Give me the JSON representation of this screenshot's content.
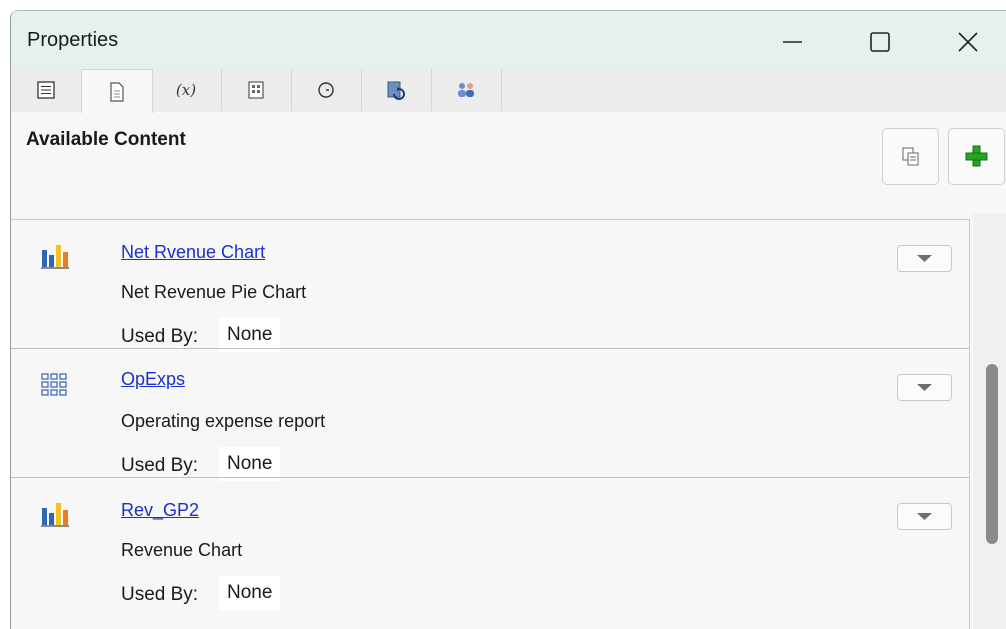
{
  "window": {
    "title": "Properties",
    "controls": {
      "minimize_icon": "minimize-icon",
      "maximize_icon": "maximize-icon",
      "close_icon": "close-icon"
    }
  },
  "tabs": [
    {
      "icon": "list-icon",
      "active": false
    },
    {
      "icon": "document-icon",
      "active": true
    },
    {
      "label": "(x)",
      "icon": "variable-icon",
      "active": false
    },
    {
      "icon": "report-icon",
      "active": false
    },
    {
      "icon": "clock-icon",
      "active": false
    },
    {
      "icon": "refresh-document-icon",
      "active": false
    },
    {
      "icon": "users-icon",
      "active": false
    }
  ],
  "panel": {
    "heading": "Available Content",
    "copy_button_icon": "copy-icon",
    "add_button_icon": "plus-icon"
  },
  "content_items": [
    {
      "icon": "bar-chart-icon",
      "name": "Net Rvenue Chart",
      "description": "Net Revenue Pie Chart",
      "used_by_label": "Used By:",
      "used_by_value": "None"
    },
    {
      "icon": "grid-report-icon",
      "name": "OpExps",
      "description": "Operating expense report",
      "used_by_label": "Used By:",
      "used_by_value": "None"
    },
    {
      "icon": "bar-chart-icon",
      "name": "Rev_GP2",
      "description": "Revenue Chart",
      "used_by_label": "Used By:",
      "used_by_value": "None"
    }
  ],
  "colors": {
    "titlebar": "#e6f1ec",
    "link": "#1b2fd0",
    "accent_green": "#24a724",
    "chart_blue": "#2f67b7",
    "chart_orange": "#f07b1a"
  }
}
